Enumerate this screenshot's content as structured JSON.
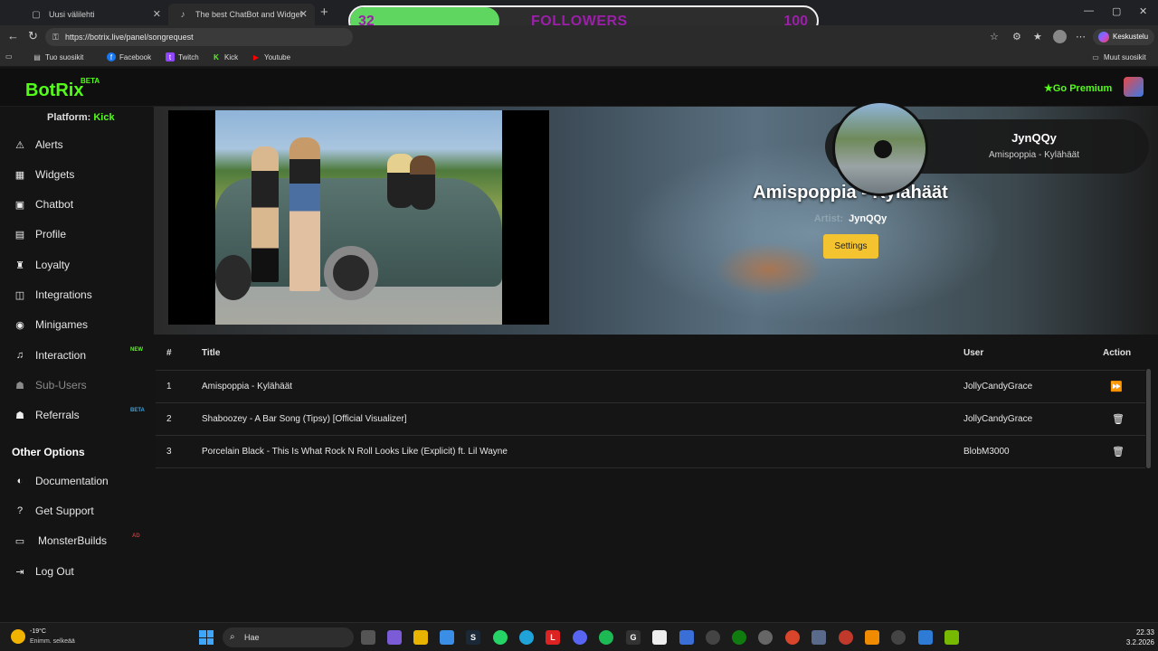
{
  "browser": {
    "tabs": [
      {
        "title": "Uusi välilehti",
        "icon": "page-icon"
      },
      {
        "title": "The best ChatBot and Widget",
        "icon": "speaker-icon"
      }
    ],
    "url": "https://botrix.live/panel/songrequest",
    "chat_pill": "Keskustelu",
    "bookmarks": [
      {
        "label": "Tuo suosikit",
        "icon": "import-icon"
      },
      {
        "label": "Facebook",
        "icon": "facebook-icon",
        "color": "#1877f2"
      },
      {
        "label": "Twitch",
        "icon": "twitch-icon",
        "color": "#9146ff"
      },
      {
        "label": "Kick",
        "icon": "kick-icon",
        "color": "#53fc18"
      },
      {
        "label": "Youtube",
        "icon": "youtube-icon",
        "color": "#ff0000"
      }
    ],
    "other_bookmarks": "Muut suosikit"
  },
  "followers_widget": {
    "current": "32",
    "label": "FOLLOWERS",
    "goal": "100",
    "progress": 0.32,
    "fill_color": "#5fd65f",
    "text_color": "#9b1fa8"
  },
  "header": {
    "logo": "BotRix",
    "logo_badge": "BETA",
    "go_premium": "Go Premium",
    "accent": "#53fc18"
  },
  "sidebar": {
    "platform_label": "Platform:",
    "platform_value": "Kick",
    "items": [
      {
        "label": "Alerts",
        "icon": "warning-icon"
      },
      {
        "label": "Widgets",
        "icon": "widgets-icon"
      },
      {
        "label": "Chatbot",
        "icon": "robot-icon"
      },
      {
        "label": "Profile",
        "icon": "profile-card-icon"
      },
      {
        "label": "Loyalty",
        "icon": "trophy-icon"
      },
      {
        "label": "Integrations",
        "icon": "integrations-icon"
      },
      {
        "label": "Minigames",
        "icon": "gamepad-icon"
      },
      {
        "label": "Interaction",
        "icon": "music-note-icon",
        "badge": "NEW"
      },
      {
        "label": "Sub-Users",
        "icon": "users-icon"
      },
      {
        "label": "Referrals",
        "icon": "user-group-icon",
        "badge": "BETA"
      }
    ],
    "other_options_heading": "Other Options",
    "other_items": [
      {
        "label": "Documentation",
        "icon": "book-icon"
      },
      {
        "label": "Get Support",
        "icon": "question-icon"
      },
      {
        "label": "MonsterBuilds",
        "icon": "laptop-icon",
        "badge": "AD"
      },
      {
        "label": "Log Out",
        "icon": "logout-icon"
      }
    ]
  },
  "player": {
    "song_title": "Amispoppia - Kylähäät",
    "artist_label": "Artist:",
    "artist_value": "JynQQy",
    "settings_button": "Settings",
    "now_playing_user": "JynQQy",
    "now_playing_song": "Amispoppia - Kylähäät"
  },
  "queue": {
    "headers": {
      "num": "#",
      "title": "Title",
      "user": "User",
      "action": "Action"
    },
    "rows": [
      {
        "num": "1",
        "title": "Amispoppia - Kylähäät",
        "user": "JollyCandyGrace",
        "action_icon": "skip-forward-icon"
      },
      {
        "num": "2",
        "title": "Shaboozey - A Bar Song (Tipsy) [Official Visualizer]",
        "user": "JollyCandyGrace",
        "action_icon": "trash-icon"
      },
      {
        "num": "3",
        "title": "Porcelain Black - This Is What Rock N Roll Looks Like (Explicit) ft. Lil Wayne",
        "user": "BlobM3000",
        "action_icon": "trash-icon"
      }
    ]
  },
  "taskbar": {
    "weather_temp": "-19°C",
    "weather_desc": "Enimm. selkeää",
    "search_placeholder": "Hae",
    "time": "22.33",
    "date": "3.2.2026"
  }
}
